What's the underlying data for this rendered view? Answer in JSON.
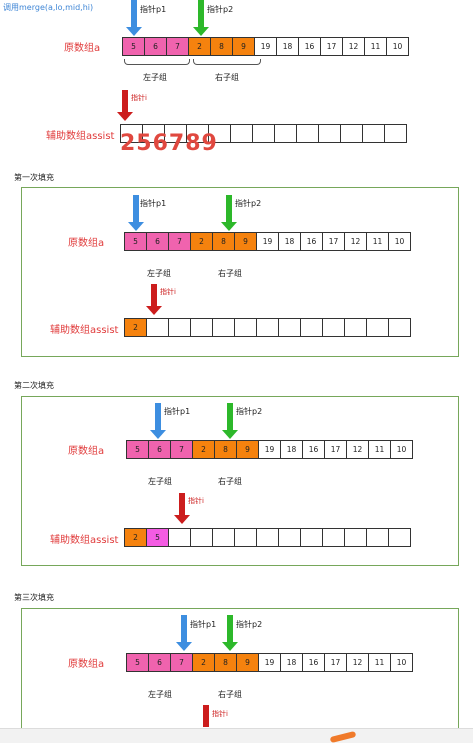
{
  "caption": "调用merge(a,lo,mid,hi)",
  "labels": {
    "original": "原数组a",
    "assist": "辅助数组assist",
    "left_group": "左子组",
    "right_group": "右子组",
    "p1": "指针p1",
    "p2": "指针p2",
    "pi": "指针i"
  },
  "result_text": "256789",
  "steps": [
    "第一次填充",
    "第二次填充",
    "第三次填充"
  ],
  "array_values": [
    "5",
    "6",
    "7",
    "2",
    "8",
    "9",
    "19",
    "18",
    "16",
    "17",
    "12",
    "11",
    "10"
  ],
  "assist_fill": {
    "s0": [],
    "s1": [
      "2"
    ],
    "s2": [
      "2",
      "5"
    ]
  },
  "colors": {
    "left": "#f063ae",
    "right": "#f5820e",
    "assist_new": "#f45ce3",
    "label_red": "#e03a3a",
    "panel_border": "#76a75a",
    "ptr_blue": "#3d8ee0",
    "ptr_green": "#2db82a",
    "ptr_red": "#cc1d1d"
  },
  "icons": {
    "p1": "blue-down-arrow-icon",
    "p2": "green-down-arrow-icon",
    "i": "red-down-arrow-icon"
  }
}
